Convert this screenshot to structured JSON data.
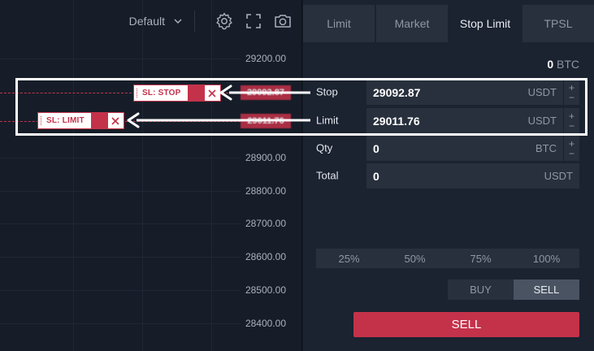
{
  "chart": {
    "timeframe": "Default",
    "price_labels": [
      "29200.00",
      "28900.00",
      "28800.00",
      "28700.00",
      "28600.00",
      "28500.00",
      "28400.00"
    ],
    "price_tags": [
      "29092.87",
      "29011.76"
    ],
    "badges": {
      "stop_label": "SL: STOP",
      "limit_label": "SL: LIMIT"
    },
    "colors": {
      "accent_red": "#c4324a",
      "background": "#161d28"
    }
  },
  "toolbar_icons": [
    "gear-icon",
    "fullscreen-icon",
    "camera-icon"
  ],
  "panel": {
    "tabs": [
      {
        "label": "Limit"
      },
      {
        "label": "Market"
      },
      {
        "label": "Stop Limit"
      },
      {
        "label": "TPSL"
      }
    ],
    "active_tab": "Stop Limit",
    "balance": {
      "amount": "0",
      "unit": "BTC"
    },
    "form": {
      "stop": {
        "label": "Stop",
        "value": "29092.87",
        "unit": "USDT"
      },
      "limit": {
        "label": "Limit",
        "value": "29011.76",
        "unit": "USDT"
      },
      "qty": {
        "label": "Qty",
        "value": "0",
        "unit": "BTC"
      },
      "total": {
        "label": "Total",
        "value": "0",
        "unit": "USDT"
      }
    },
    "percent_options": [
      "25%",
      "50%",
      "75%",
      "100%"
    ],
    "side": {
      "buy": "BUY",
      "sell": "SELL",
      "active": "SELL"
    },
    "submit_label": "SELL"
  }
}
